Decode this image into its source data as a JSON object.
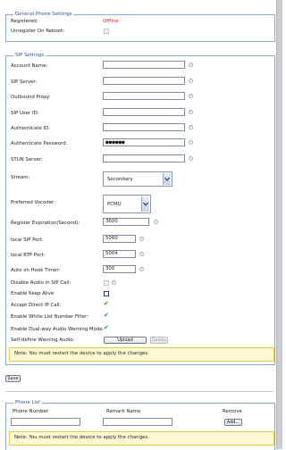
{
  "general": {
    "legend": "General Phone Settings",
    "registered_label": "Registered:",
    "registered_value": "Offline",
    "unregister_label": "Unregister On Reboot:"
  },
  "sip": {
    "legend": "SIP Settings",
    "account_name_label": "Account Name:",
    "sip_server_label": "SIP Server:",
    "outbound_proxy_label": "Outbound Proxy:",
    "sip_user_id_label": "SIP User ID:",
    "auth_id_label": "Authenticate ID:",
    "auth_password_label": "Authenticate Password:",
    "auth_password_value": "●●●●●●",
    "stun_server_label": "STUN Server:",
    "stream_label": "Stream:",
    "stream_value": "Secondary",
    "vocoder_label": "Preferred Vocoder:",
    "vocoder_value": "PCMU",
    "reg_expiration_label": "Register Expiration(Second):",
    "reg_expiration_value": "3600",
    "local_sip_port_label": "local SIP Port:",
    "local_sip_port_value": "5060",
    "local_rtp_port_label": "local RTP Port:",
    "local_rtp_port_value": "5004",
    "auto_hook_label": "Auto on Hook Timer:",
    "auto_hook_value": "300",
    "disable_audio_label": "Disable Audio in SIP Call:",
    "keep_alive_label": "Enable Keep Alive",
    "direct_ip_label": "Accept Direct IP Call:",
    "white_list_label": "Enable White List Number Filter:",
    "dual_way_label": "Enable Dual-way Audio Warning Mode:",
    "warning_audio_label": "Self-define Warning Audio:",
    "upload_button": "Upload",
    "delete_button": "Delete",
    "note": "Note: You must restart the device to apply the changes."
  },
  "save_button": "Save",
  "phone_list": {
    "legend": "Phone List",
    "phone_number_header": "Phone Number",
    "remark_name_header": "Remark Name",
    "remove_header": "Remove",
    "add_button": "Add...",
    "note": "Note: You must restart the device to apply the changes."
  },
  "colors": {
    "offline": "#d21f1f",
    "legend": "#2a56a0",
    "note_bg": "#fefbd4",
    "check_green": "#1d9b2d"
  }
}
